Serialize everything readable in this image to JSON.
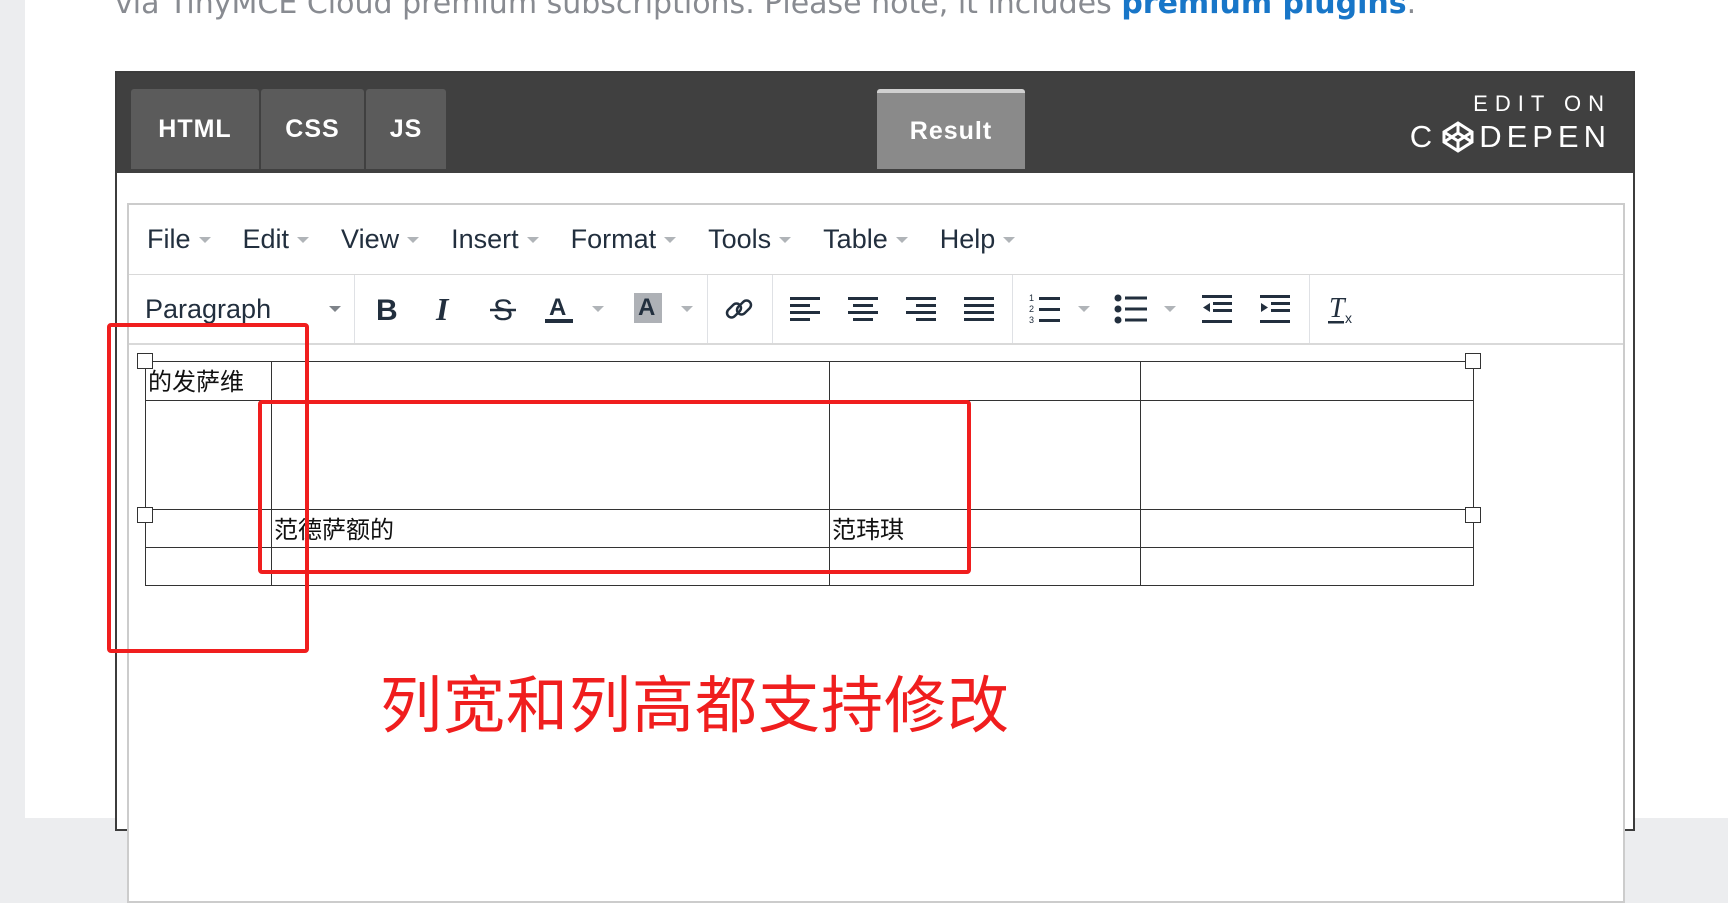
{
  "intro": {
    "text": "via TinyMCE Cloud premium subscriptions. Please note, it includes ",
    "link": "premium plugins",
    "end": "."
  },
  "codepen": {
    "tabs": [
      "HTML",
      "CSS",
      "JS"
    ],
    "result_tab": "Result",
    "edit_on": "EDIT ON",
    "brand_left": "C",
    "brand_right": "DEPEN"
  },
  "editor": {
    "menu": [
      "File",
      "Edit",
      "View",
      "Insert",
      "Format",
      "Tools",
      "Table",
      "Help"
    ],
    "block_format": "Paragraph",
    "toolbar_icons": [
      "bold-icon",
      "italic-icon",
      "strikethrough-icon",
      "text-color-icon",
      "background-color-icon",
      "link-icon",
      "align-left-icon",
      "align-center-icon",
      "align-right-icon",
      "align-justify-icon",
      "numbered-list-icon",
      "bullet-list-icon",
      "outdent-icon",
      "indent-icon",
      "clear-formatting-icon"
    ],
    "table": {
      "rows": [
        [
          "的发萨维",
          "",
          "",
          ""
        ],
        [
          "",
          "",
          "",
          ""
        ],
        [
          "",
          "范德萨额的",
          "范玮琪",
          ""
        ],
        [
          "",
          "",
          "",
          ""
        ]
      ]
    }
  },
  "annotation": {
    "text": "列宽和列高都支持修改",
    "color": "#f01e1e"
  }
}
